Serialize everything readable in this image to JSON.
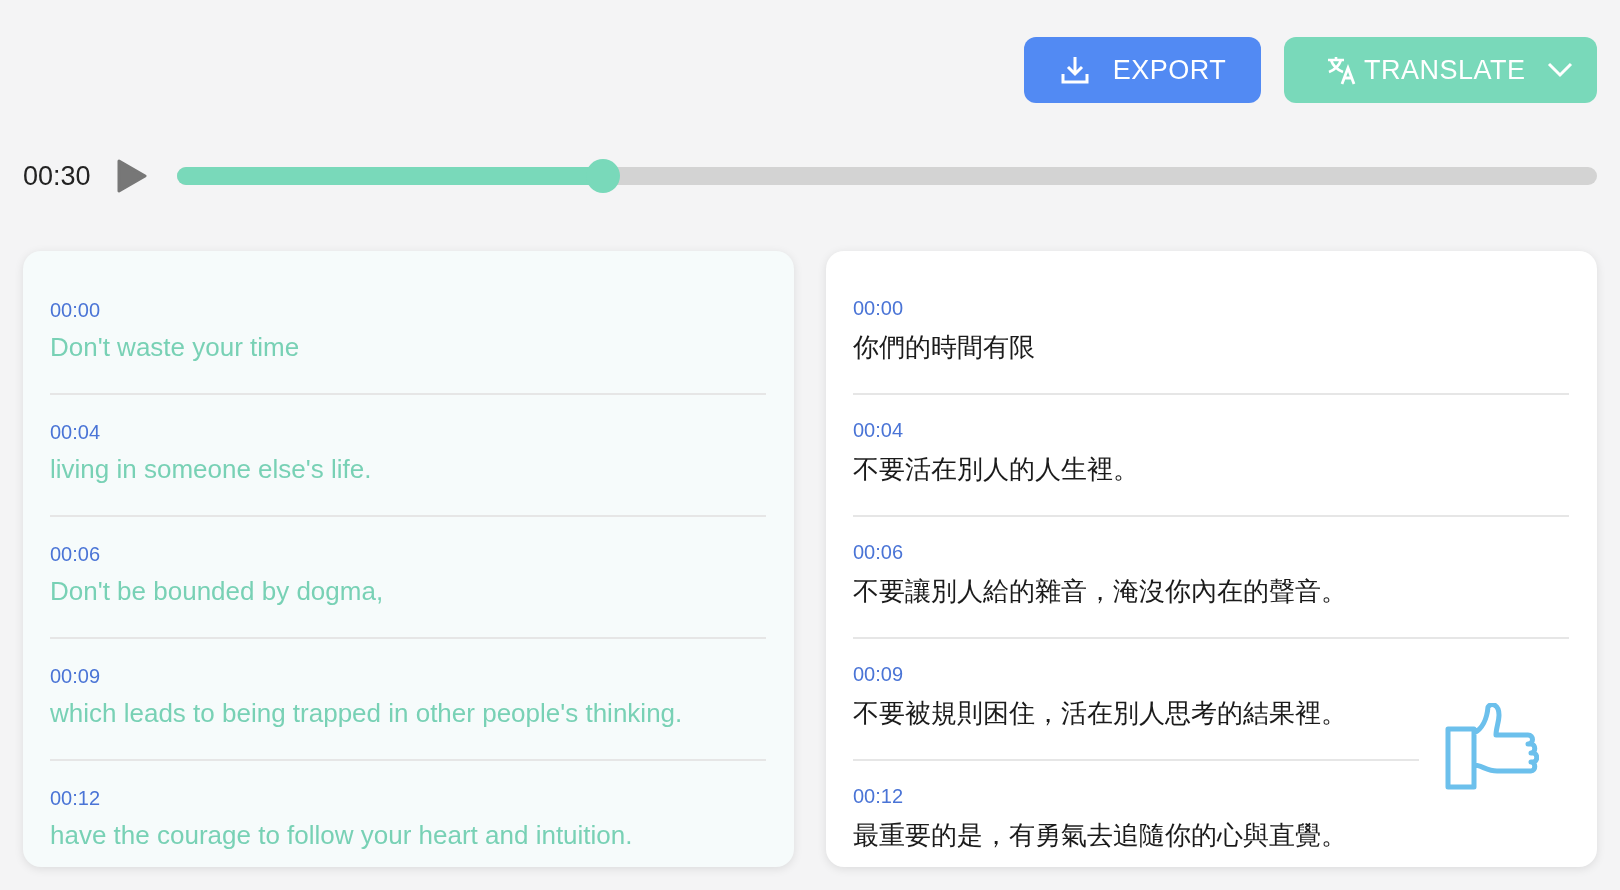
{
  "toolbar": {
    "export_label": "EXPORT",
    "translate_label": "TRANSLATE"
  },
  "player": {
    "time": "00:30",
    "level": 0.3
  },
  "panels": [
    {
      "selected": true,
      "lines": [
        {
          "time": "00:00",
          "text": "Don't waste your time"
        },
        {
          "time": "00:04",
          "text": "living in someone else's life."
        },
        {
          "time": "00:06",
          "text": "Don't be bounded by dogma,"
        },
        {
          "time": "00:09",
          "text": "which leads to being trapped in other people's thinking."
        },
        {
          "time": "00:12",
          "text": "have the courage to follow your heart and intuition."
        }
      ]
    },
    {
      "selected": false,
      "lines": [
        {
          "time": "00:00",
          "text": "你們的時間有限"
        },
        {
          "time": "00:04",
          "text": "不要活在別人的人生裡。"
        },
        {
          "time": "00:06",
          "text": "不要讓別人給的雜音，淹沒你內在的聲音。"
        },
        {
          "time": "00:09",
          "text": "不要被規則困住，活在別人思考的結果裡。"
        },
        {
          "time": "00:12",
          "text": "最重要的是，有勇氣去追隨你的心與直覺。"
        }
      ]
    }
  ]
}
